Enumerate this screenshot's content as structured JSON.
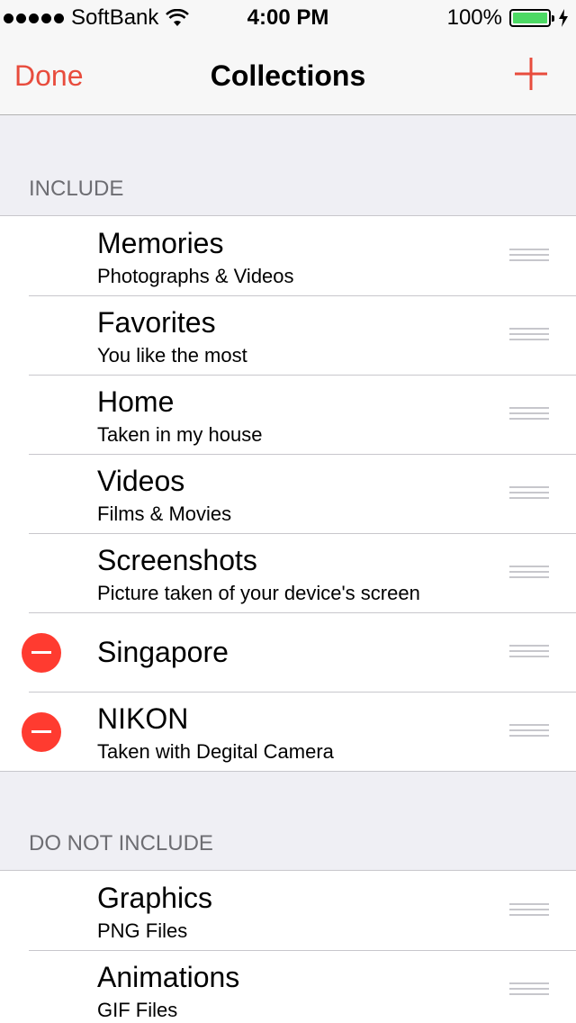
{
  "status_bar": {
    "carrier": "SoftBank",
    "time": "4:00 PM",
    "battery": "100%"
  },
  "nav": {
    "done": "Done",
    "title": "Collections",
    "add_icon": "plus-icon"
  },
  "include": {
    "header": "INCLUDE",
    "items": [
      {
        "title": "Memories",
        "subtitle": "Photographs & Videos"
      },
      {
        "title": "Favorites",
        "subtitle": "You like the most"
      },
      {
        "title": "Home",
        "subtitle": "Taken in my house"
      },
      {
        "title": "Videos",
        "subtitle": "Films & Movies"
      },
      {
        "title": "Screenshots",
        "subtitle": "Picture taken of your device's screen"
      },
      {
        "title": "Singapore",
        "subtitle": ""
      },
      {
        "title": "NIKON",
        "subtitle": "Taken with Degital Camera"
      }
    ]
  },
  "exclude": {
    "header": "DO NOT INCLUDE",
    "items": [
      {
        "title": "Graphics",
        "subtitle": "PNG Files"
      },
      {
        "title": "Animations",
        "subtitle": "GIF Files"
      }
    ]
  },
  "colors": {
    "accent": "#e84c3d",
    "delete": "#ff3b30",
    "battery": "#4cd964"
  }
}
